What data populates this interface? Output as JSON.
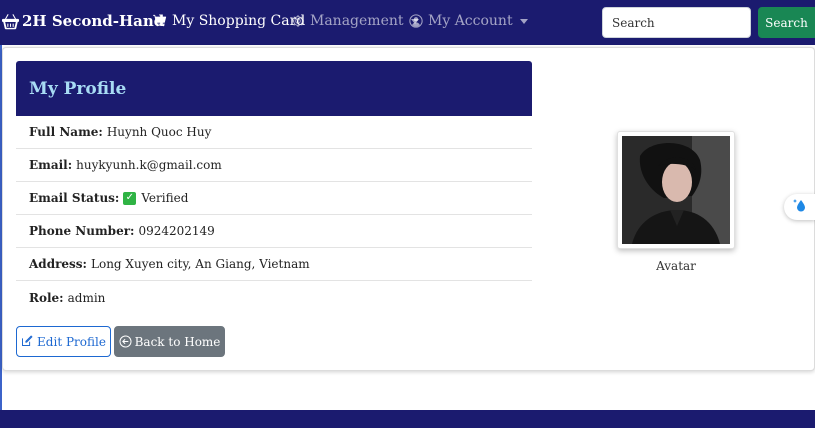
{
  "navbar": {
    "brand": "2H Second-Hand",
    "items": [
      {
        "label": "My Shopping Card",
        "icon": "cart-icon"
      },
      {
        "label": "Management",
        "icon": "gear-icon",
        "dropdown": true
      },
      {
        "label": "My Account",
        "icon": "user-circle-icon",
        "dropdown": true
      }
    ],
    "search": {
      "placeholder": "Search",
      "value": "",
      "button_label": "Search"
    }
  },
  "profile": {
    "title": "My Profile",
    "fields": [
      {
        "label": "Full Name:",
        "value": "Huynh Quoc Huy"
      },
      {
        "label": "Email:",
        "value": "huykyunh.k@gmail.com"
      },
      {
        "label": "Email Status:",
        "value": "Verified",
        "icon": "check-badge-icon"
      },
      {
        "label": "Phone Number:",
        "value": "0924202149"
      },
      {
        "label": "Address:",
        "value": "Long Xuyen city, An Giang, Vietnam"
      },
      {
        "label": "Role:",
        "value": "admin"
      }
    ],
    "edit_button": "Edit Profile",
    "home_button": "Back to Home",
    "avatar_caption": "Avatar"
  },
  "colors": {
    "navbar": "#1b1b6f",
    "card_title": "#a8dcf4",
    "search_button": "#198754",
    "edit_button": "#1d68d1",
    "home_button": "#6c757d",
    "verified": "#2fb344"
  }
}
